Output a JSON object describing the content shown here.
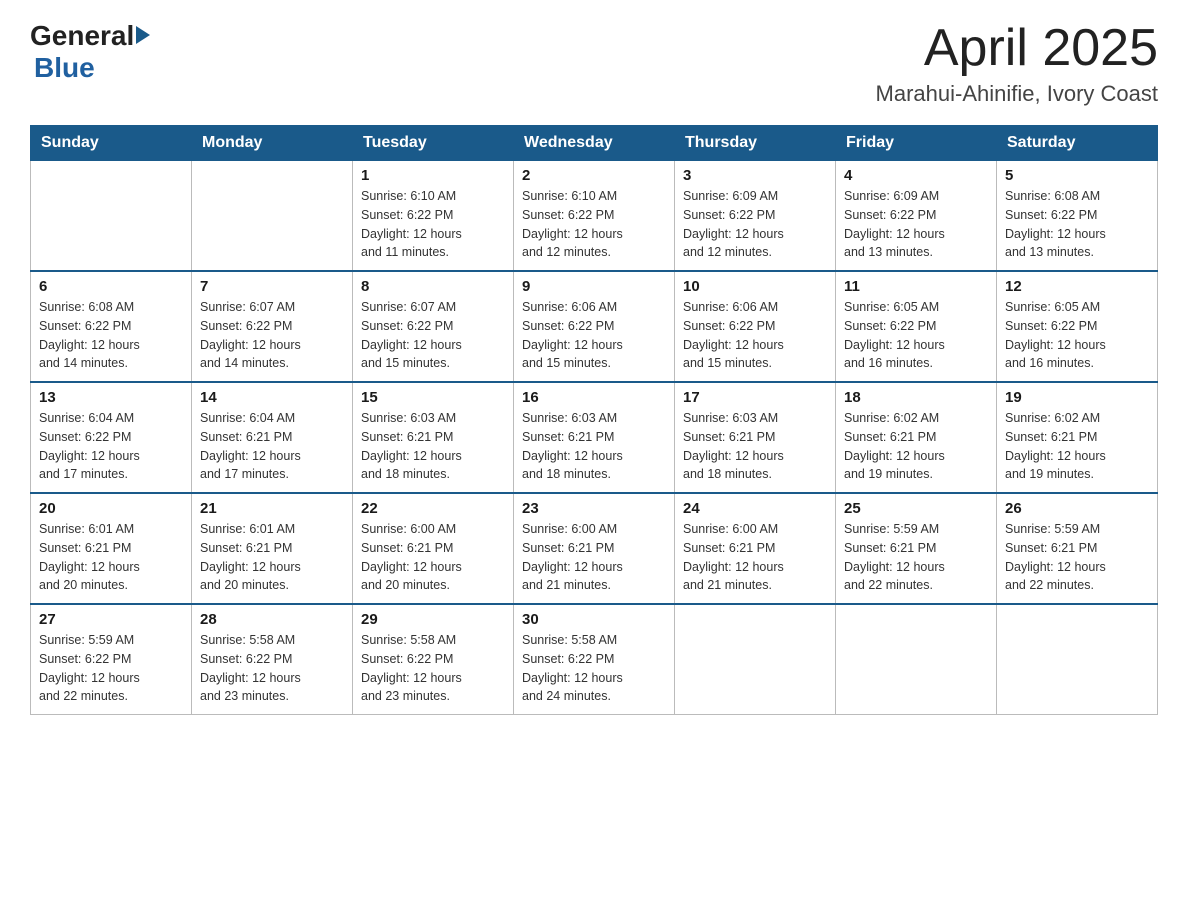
{
  "header": {
    "logo_general": "General",
    "logo_blue": "Blue",
    "title": "April 2025",
    "subtitle": "Marahui-Ahinifie, Ivory Coast"
  },
  "weekdays": [
    "Sunday",
    "Monday",
    "Tuesday",
    "Wednesday",
    "Thursday",
    "Friday",
    "Saturday"
  ],
  "weeks": [
    [
      {
        "day": "",
        "info": ""
      },
      {
        "day": "",
        "info": ""
      },
      {
        "day": "1",
        "info": "Sunrise: 6:10 AM\nSunset: 6:22 PM\nDaylight: 12 hours\nand 11 minutes."
      },
      {
        "day": "2",
        "info": "Sunrise: 6:10 AM\nSunset: 6:22 PM\nDaylight: 12 hours\nand 12 minutes."
      },
      {
        "day": "3",
        "info": "Sunrise: 6:09 AM\nSunset: 6:22 PM\nDaylight: 12 hours\nand 12 minutes."
      },
      {
        "day": "4",
        "info": "Sunrise: 6:09 AM\nSunset: 6:22 PM\nDaylight: 12 hours\nand 13 minutes."
      },
      {
        "day": "5",
        "info": "Sunrise: 6:08 AM\nSunset: 6:22 PM\nDaylight: 12 hours\nand 13 minutes."
      }
    ],
    [
      {
        "day": "6",
        "info": "Sunrise: 6:08 AM\nSunset: 6:22 PM\nDaylight: 12 hours\nand 14 minutes."
      },
      {
        "day": "7",
        "info": "Sunrise: 6:07 AM\nSunset: 6:22 PM\nDaylight: 12 hours\nand 14 minutes."
      },
      {
        "day": "8",
        "info": "Sunrise: 6:07 AM\nSunset: 6:22 PM\nDaylight: 12 hours\nand 15 minutes."
      },
      {
        "day": "9",
        "info": "Sunrise: 6:06 AM\nSunset: 6:22 PM\nDaylight: 12 hours\nand 15 minutes."
      },
      {
        "day": "10",
        "info": "Sunrise: 6:06 AM\nSunset: 6:22 PM\nDaylight: 12 hours\nand 15 minutes."
      },
      {
        "day": "11",
        "info": "Sunrise: 6:05 AM\nSunset: 6:22 PM\nDaylight: 12 hours\nand 16 minutes."
      },
      {
        "day": "12",
        "info": "Sunrise: 6:05 AM\nSunset: 6:22 PM\nDaylight: 12 hours\nand 16 minutes."
      }
    ],
    [
      {
        "day": "13",
        "info": "Sunrise: 6:04 AM\nSunset: 6:22 PM\nDaylight: 12 hours\nand 17 minutes."
      },
      {
        "day": "14",
        "info": "Sunrise: 6:04 AM\nSunset: 6:21 PM\nDaylight: 12 hours\nand 17 minutes."
      },
      {
        "day": "15",
        "info": "Sunrise: 6:03 AM\nSunset: 6:21 PM\nDaylight: 12 hours\nand 18 minutes."
      },
      {
        "day": "16",
        "info": "Sunrise: 6:03 AM\nSunset: 6:21 PM\nDaylight: 12 hours\nand 18 minutes."
      },
      {
        "day": "17",
        "info": "Sunrise: 6:03 AM\nSunset: 6:21 PM\nDaylight: 12 hours\nand 18 minutes."
      },
      {
        "day": "18",
        "info": "Sunrise: 6:02 AM\nSunset: 6:21 PM\nDaylight: 12 hours\nand 19 minutes."
      },
      {
        "day": "19",
        "info": "Sunrise: 6:02 AM\nSunset: 6:21 PM\nDaylight: 12 hours\nand 19 minutes."
      }
    ],
    [
      {
        "day": "20",
        "info": "Sunrise: 6:01 AM\nSunset: 6:21 PM\nDaylight: 12 hours\nand 20 minutes."
      },
      {
        "day": "21",
        "info": "Sunrise: 6:01 AM\nSunset: 6:21 PM\nDaylight: 12 hours\nand 20 minutes."
      },
      {
        "day": "22",
        "info": "Sunrise: 6:00 AM\nSunset: 6:21 PM\nDaylight: 12 hours\nand 20 minutes."
      },
      {
        "day": "23",
        "info": "Sunrise: 6:00 AM\nSunset: 6:21 PM\nDaylight: 12 hours\nand 21 minutes."
      },
      {
        "day": "24",
        "info": "Sunrise: 6:00 AM\nSunset: 6:21 PM\nDaylight: 12 hours\nand 21 minutes."
      },
      {
        "day": "25",
        "info": "Sunrise: 5:59 AM\nSunset: 6:21 PM\nDaylight: 12 hours\nand 22 minutes."
      },
      {
        "day": "26",
        "info": "Sunrise: 5:59 AM\nSunset: 6:21 PM\nDaylight: 12 hours\nand 22 minutes."
      }
    ],
    [
      {
        "day": "27",
        "info": "Sunrise: 5:59 AM\nSunset: 6:22 PM\nDaylight: 12 hours\nand 22 minutes."
      },
      {
        "day": "28",
        "info": "Sunrise: 5:58 AM\nSunset: 6:22 PM\nDaylight: 12 hours\nand 23 minutes."
      },
      {
        "day": "29",
        "info": "Sunrise: 5:58 AM\nSunset: 6:22 PM\nDaylight: 12 hours\nand 23 minutes."
      },
      {
        "day": "30",
        "info": "Sunrise: 5:58 AM\nSunset: 6:22 PM\nDaylight: 12 hours\nand 24 minutes."
      },
      {
        "day": "",
        "info": ""
      },
      {
        "day": "",
        "info": ""
      },
      {
        "day": "",
        "info": ""
      }
    ]
  ]
}
